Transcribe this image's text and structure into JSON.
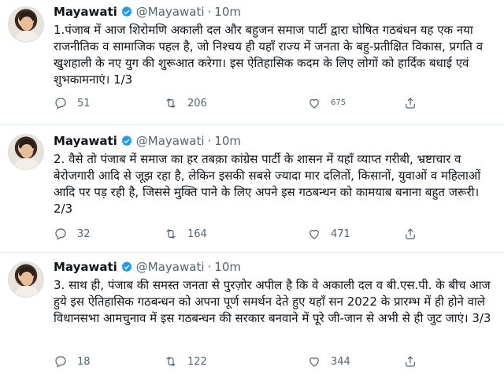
{
  "tweets": [
    {
      "name": "Mayawati",
      "handle": "@Mayawati",
      "separator": "·",
      "time": "10m",
      "text": "1.पंजाब में आज शिरोमणि अकाली दल और बहुजन समाज पार्टी द्वारा घोषित गठबंधन यह एक नया राजनीतिक व सामाजिक पहल है, जो निश्चय ही यहाँ राज्य में जनता के बहु-प्रतीक्षित विकास, प्रगति व खुशहाली के नए युग की शुरूआत करेगा। इस ऐतिहासिक कदम के लिए लोगों को हार्दिक बधाई एवं शुभकामनाएं। 1/3",
      "replies": "51",
      "retweets": "206",
      "likes": "675"
    },
    {
      "name": "Mayawati",
      "handle": "@Mayawati",
      "separator": "·",
      "time": "10m",
      "text": "2. वैसे तो पंजाब में समाज का हर तबक़ा कांग्रेस पार्टी के शासन में यहाँ व्याप्त गरीबी, भ्रष्टाचार व बेरोजगारी आदि से जूझ रहा है, लेकिन इसकी सबसे ज्यादा मार दलितों, किसानों, युवाओं व महिलाओं आदि पर पड़ रही है, जिससे मुक्ति पाने के लिए अपने इस गठबन्धन को कामयाब बनाना बहुत जरूरी। 2/3",
      "replies": "32",
      "retweets": "164",
      "likes": "471"
    },
    {
      "name": "Mayawati",
      "handle": "@Mayawati",
      "separator": "·",
      "time": "10m",
      "text": "3. साथ ही, पंजाब की समस्त जनता से पुरज़ोर अपील है कि वे अकाली दल व बी.एस.पी. के बीच आज हुये इस ऐतिहासिक गठबन्धन को अपना पूर्ण समर्थन देते हुए यहाँ सन 2022 के प्रारम्भ में ही होने वाले विधानसभा आमचुनाव में इस गठबन्धन की सरकार बनवाने में पूरे जी-जान से अभी से ही जुट जाएं। 3/3",
      "replies": "18",
      "retweets": "122",
      "likes": "344"
    }
  ],
  "colors": {
    "verified": "#1d9bf0",
    "muted": "#536471",
    "divider": "#e6ecf0",
    "text": "#0f1419"
  },
  "icons": [
    "verified-badge-icon",
    "reply-icon",
    "retweet-icon",
    "like-icon",
    "share-icon"
  ]
}
